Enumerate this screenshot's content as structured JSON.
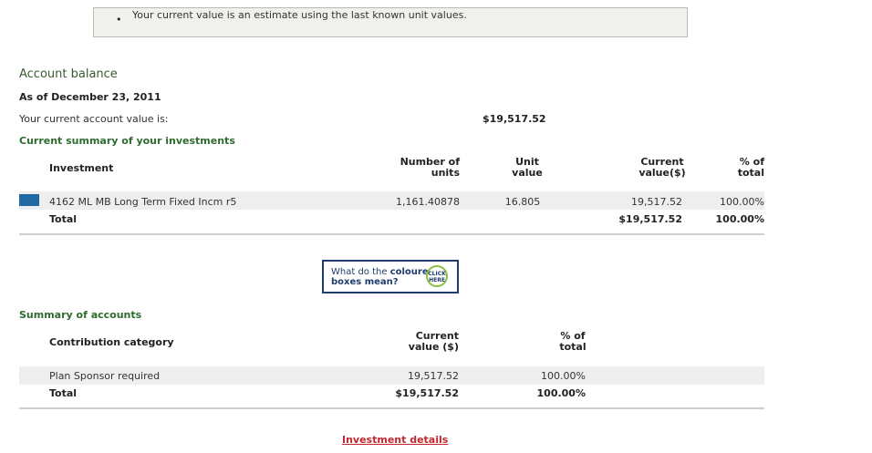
{
  "note": {
    "bullet": "•",
    "text": "Your current value is an estimate using the last known unit values."
  },
  "account_balance": {
    "title": "Account balance",
    "as_of": "As of December 23, 2011",
    "current_value_label": "Your current account value is:",
    "current_value": "$19,517.52"
  },
  "investments": {
    "title": "Current summary of your investments",
    "headers": {
      "investment": "Investment",
      "units_1": "Number of",
      "units_2": "units",
      "unit_value_1": "Unit",
      "unit_value_2": "value",
      "current_1": "Current",
      "current_2": "value($)",
      "pct_1": "% of",
      "pct_2": "total"
    },
    "rows": [
      {
        "name": "4162 ML MB Long Term Fixed Incm r5",
        "units": "1,161.40878",
        "unit_value": "16.805",
        "current": "19,517.52",
        "pct": "100.00%",
        "color": "#1f6aa5"
      }
    ],
    "total": {
      "label": "Total",
      "current": "$19,517.52",
      "pct": "100.00%"
    }
  },
  "coloured_boxes": {
    "text_1": "What do the ",
    "text_bold": "coloured",
    "text_2": "boxes mean?",
    "click_1": "CLICK",
    "click_2": "HERE"
  },
  "accounts": {
    "title": "Summary of accounts",
    "headers": {
      "category": "Contribution category",
      "current_1": "Current",
      "current_2": "value ($)",
      "pct_1": "% of",
      "pct_2": "total"
    },
    "rows": [
      {
        "category": "Plan Sponsor required",
        "current": "19,517.52",
        "pct": "100.00%"
      }
    ],
    "total": {
      "label": "Total",
      "current": "$19,517.52",
      "pct": "100.00%"
    }
  },
  "links": {
    "investment_details": "Investment details"
  }
}
